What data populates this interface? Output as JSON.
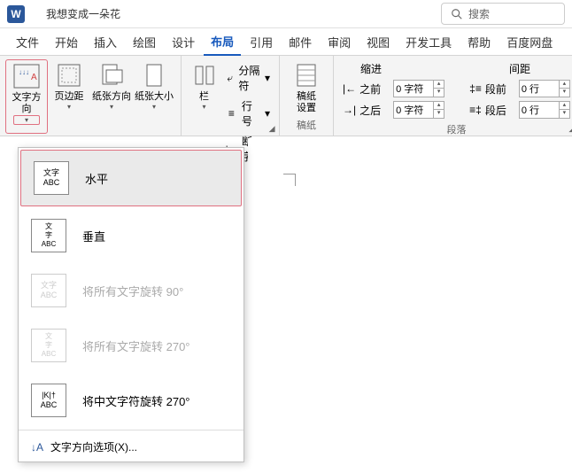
{
  "title": {
    "doc_name": "我想变成一朵花"
  },
  "search": {
    "placeholder": "搜索"
  },
  "tabs": [
    "文件",
    "开始",
    "插入",
    "绘图",
    "设计",
    "布局",
    "引用",
    "邮件",
    "审阅",
    "视图",
    "开发工具",
    "帮助",
    "百度网盘"
  ],
  "active_tab_index": 5,
  "ribbon": {
    "text_direction": "文字方向",
    "margins": "页边距",
    "orientation": "纸张方向",
    "size": "纸张大小",
    "columns": "栏",
    "breaks": "分隔符",
    "line_numbers": "行号",
    "hyphenation": "断字",
    "manuscript": "稿纸\n设置",
    "manuscript_label": "稿纸",
    "indent_label": "缩进",
    "spacing_label": "间距",
    "before_text": "之前",
    "after_text": "之后",
    "before_para": "段前",
    "after_para": "段后",
    "indent_before_val": "0 字符",
    "indent_after_val": "0 字符",
    "space_before_val": "0 行",
    "space_after_val": "0 行",
    "paragraph_label": "段落"
  },
  "dropdown": {
    "items": [
      {
        "icon_text": "文字\nABC",
        "label": "水平",
        "selected": true,
        "disabled": false
      },
      {
        "icon_text": "文\n字\nABC",
        "label": "垂直",
        "selected": false,
        "disabled": false
      },
      {
        "icon_text": "文字\nABC",
        "label": "将所有文字旋转 90°",
        "selected": false,
        "disabled": true
      },
      {
        "icon_text": "文\n字\nABC",
        "label": "将所有文字旋转 270°",
        "selected": false,
        "disabled": true
      },
      {
        "icon_text": "|K|†\nABC",
        "label": "将中文字符旋转 270°",
        "selected": false,
        "disabled": false
      }
    ],
    "footer": "文字方向选项(X)..."
  }
}
